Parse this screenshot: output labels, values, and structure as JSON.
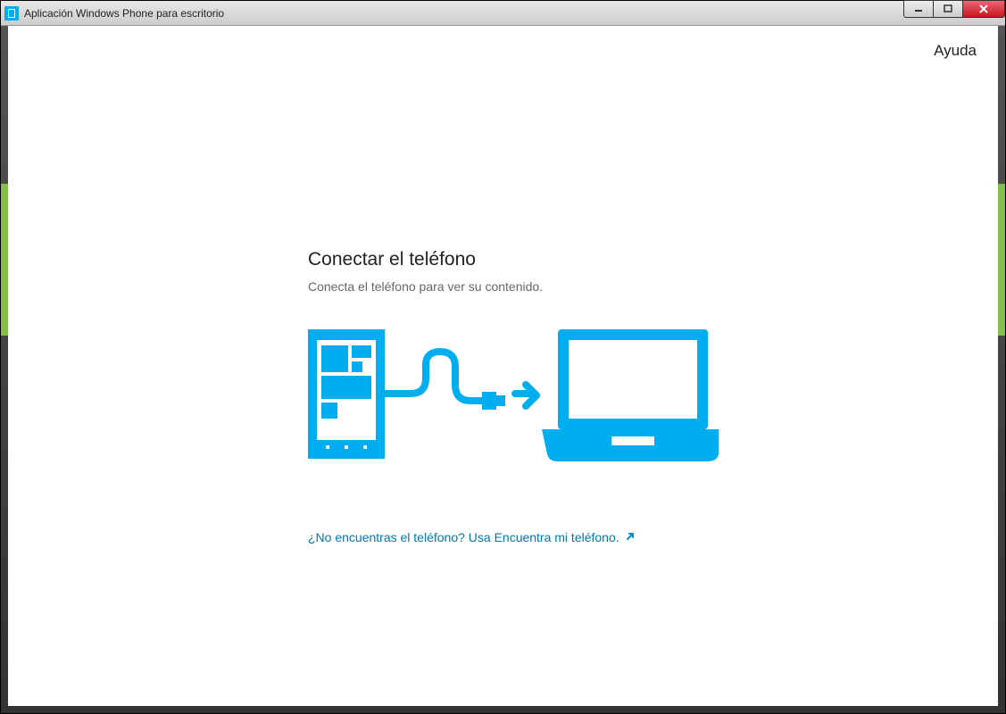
{
  "window": {
    "title": "Aplicación Windows Phone para escritorio"
  },
  "header": {
    "help_label": "Ayuda"
  },
  "main": {
    "heading": "Conectar el teléfono",
    "subtext": "Conecta el teléfono para ver su contenido.",
    "find_phone_link": "¿No encuentras el teléfono? Usa Encuentra mi teléfono."
  },
  "colors": {
    "accent": "#00aeef",
    "link": "#0078b0"
  }
}
